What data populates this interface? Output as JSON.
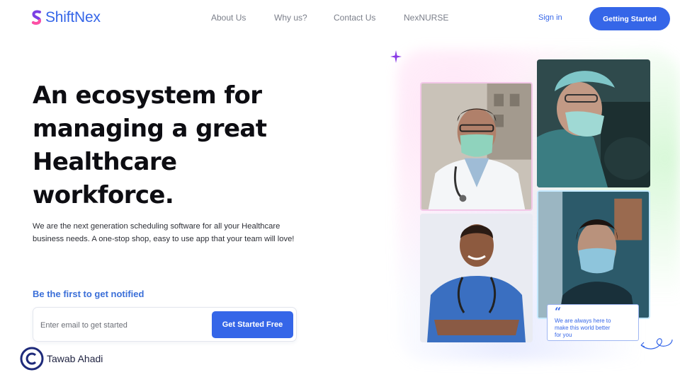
{
  "brand": {
    "name": "ShiftNex",
    "accent": "#3566e8",
    "logo_icon": "s-logo-icon"
  },
  "nav": {
    "items": [
      {
        "label": "About Us"
      },
      {
        "label": "Why us?"
      },
      {
        "label": "Contact Us"
      },
      {
        "label": "NexNURSE"
      }
    ],
    "signin_label": "Sign in",
    "cta_label": "Getting Started"
  },
  "hero": {
    "headline_lines": [
      "An ecosystem for",
      "managing a great",
      "Healthcare",
      "workforce."
    ],
    "subtext_lines": [
      "We are the next generation scheduling software for all your Healthcare",
      "business needs. A one-stop shop, easy to use app that your team will love!"
    ],
    "notify_label": "Be the first to get notified",
    "email_placeholder": "Enter email to get started",
    "email_button": "Get Started Free"
  },
  "quote_card": {
    "lines": [
      "We are always here to",
      "make this world better",
      "for you"
    ]
  },
  "credit": {
    "text": "Tawab Ahadi",
    "icon": "copyright-icon"
  },
  "icons": [
    "s-logo-icon",
    "sparkle-icon",
    "quote-icon",
    "squiggle-arrow-icon",
    "copyright-icon"
  ]
}
